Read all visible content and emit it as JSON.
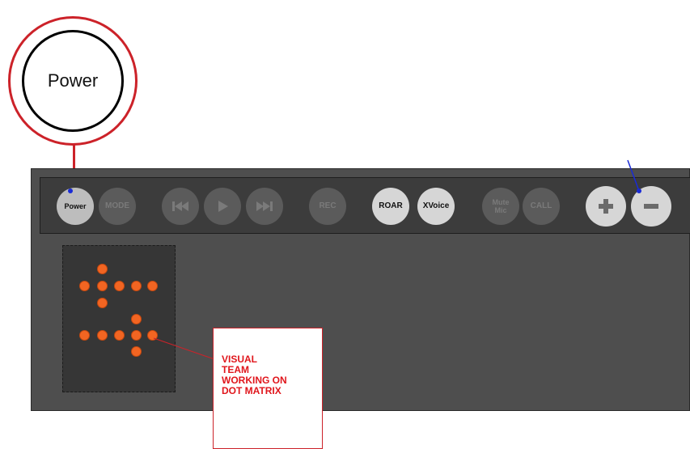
{
  "callout": {
    "label": "Power",
    "accent": "#cc2229"
  },
  "toolbar": {
    "buttons": [
      {
        "id": "power",
        "label": "Power",
        "state": "active"
      },
      {
        "id": "mode",
        "label": "MODE",
        "state": "disabled"
      },
      {
        "id": "prev",
        "icon": "skip-back-icon",
        "state": "disabled"
      },
      {
        "id": "play",
        "icon": "play-icon",
        "state": "disabled"
      },
      {
        "id": "next",
        "icon": "skip-forward-icon",
        "state": "disabled"
      },
      {
        "id": "rec",
        "label": "REC",
        "state": "disabled"
      },
      {
        "id": "roar",
        "label": "ROAR",
        "state": "active"
      },
      {
        "id": "xvoice",
        "label": "XVoice",
        "state": "active"
      },
      {
        "id": "mute-mic",
        "label": "Mute\nMic",
        "state": "disabled"
      },
      {
        "id": "call",
        "label": "CALL",
        "state": "disabled"
      },
      {
        "id": "plus",
        "icon": "plus-icon",
        "state": "active"
      },
      {
        "id": "minus",
        "icon": "minus-icon",
        "state": "active"
      }
    ]
  },
  "dot_matrix": {
    "led_color": "#f26522"
  },
  "note": {
    "text": "VISUAL\nTEAM\nWORKING ON\nDOT MATRIX",
    "color": "#e0161c"
  }
}
